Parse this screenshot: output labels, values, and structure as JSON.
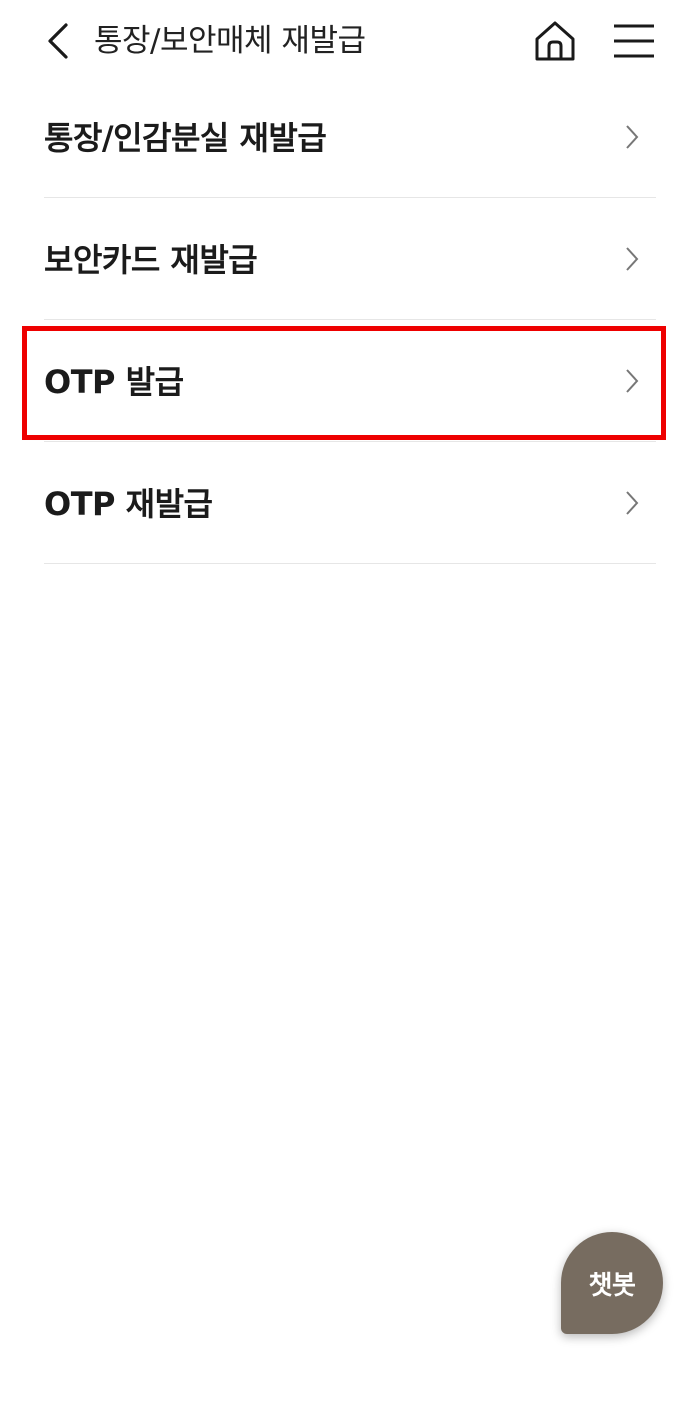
{
  "header": {
    "title": "통장/보안매체 재발급",
    "back_icon": "chevron-left-icon",
    "home_icon": "home-icon",
    "menu_icon": "hamburger-menu-icon"
  },
  "menu": {
    "items": [
      {
        "label": "통장/인감분실 재발급"
      },
      {
        "label": "보안카드 재발급"
      },
      {
        "label": "OTP 발급"
      },
      {
        "label": "OTP 재발급"
      }
    ]
  },
  "chatbot": {
    "label": "챗봇"
  },
  "colors": {
    "highlight": "#ee0000",
    "chatbot_bg": "#776c60",
    "divider": "#e6e6e6"
  }
}
